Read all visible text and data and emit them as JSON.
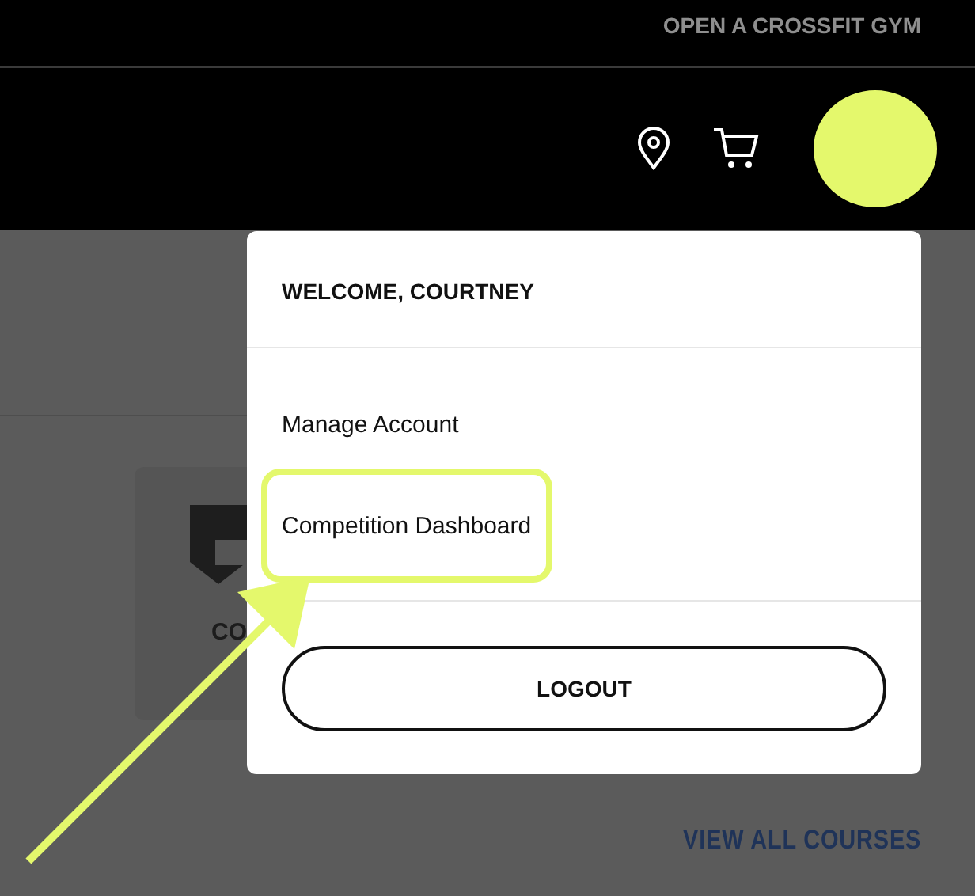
{
  "top_bar": {
    "link": "OPEN A CROSSFIT GYM"
  },
  "background": {
    "card_title": "CO",
    "link": "VIEW ALL COURSES"
  },
  "account_menu": {
    "greeting": "WELCOME, COURTNEY",
    "items": [
      {
        "label": "Manage Account",
        "highlighted": false
      },
      {
        "label": "Competition Dashboard",
        "highlighted": true
      }
    ],
    "logout": "LOGOUT"
  }
}
